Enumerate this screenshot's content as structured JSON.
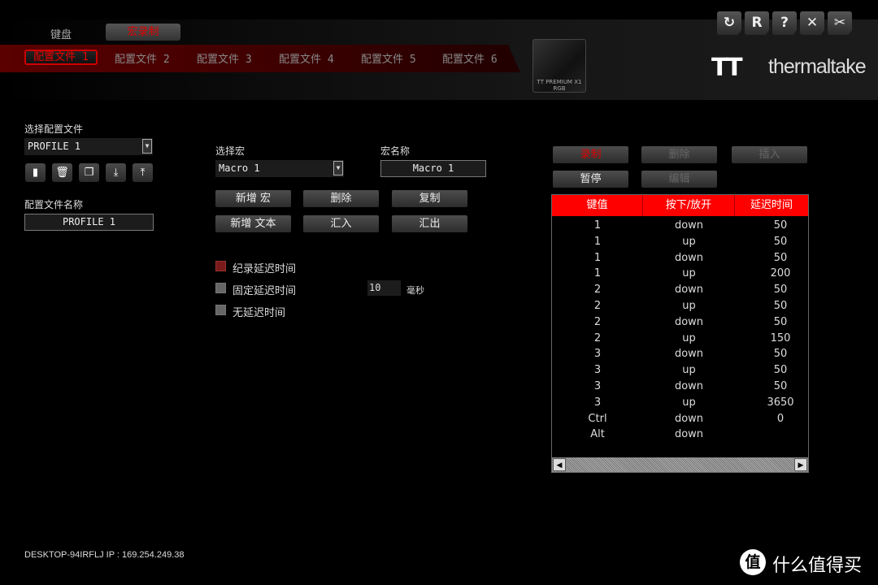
{
  "main_tabs": {
    "keyboard": "键盘",
    "macro": "宏录制"
  },
  "profile_tabs": [
    "配置文件 1",
    "配置文件 2",
    "配置文件 3",
    "配置文件 4",
    "配置文件 5",
    "配置文件 6"
  ],
  "device": {
    "name": "TT PREMIUM X1 RGB"
  },
  "window_buttons": [
    "refresh",
    "reset",
    "help",
    "close",
    "settings"
  ],
  "window_button_glyphs": {
    "refresh": "↻",
    "reset": "R",
    "help": "?",
    "close": "✕",
    "settings": "✂"
  },
  "brand": {
    "logo_mark": "TT",
    "name": "thermaltake"
  },
  "left": {
    "select_profile_label": "选择配置文件",
    "profile_value": "PROFILE 1",
    "profile_name_label": "配置文件名称",
    "profile_name_value": "PROFILE 1",
    "icons": {
      "new": "▮",
      "delete": "🗑",
      "copy": "❐",
      "import": "⤓",
      "export": "⤒"
    }
  },
  "middle": {
    "select_macro_label": "选择宏",
    "macro_value": "Macro 1",
    "macro_name_label": "宏名称",
    "macro_name_value": "Macro 1",
    "buttons": {
      "new_macro": "新增 宏",
      "delete": "删除",
      "copy": "复制",
      "new_text": "新增 文本",
      "import": "汇入",
      "export": "汇出"
    },
    "delay_options": {
      "record": "纪录延迟时间",
      "fixed": "固定延迟时间",
      "none": "无延迟时间"
    },
    "selected_delay_option": "record",
    "fixed_delay_value": "10",
    "fixed_delay_unit": "毫秒"
  },
  "right": {
    "buttons": {
      "record": "录制",
      "delete": "删除",
      "insert": "插入",
      "pause": "暂停",
      "edit": "编辑"
    },
    "table": {
      "headers": [
        "键值",
        "按下/放开",
        "延迟时间"
      ],
      "rows": [
        [
          "1",
          "down",
          "50"
        ],
        [
          "1",
          "up",
          "50"
        ],
        [
          "1",
          "down",
          "50"
        ],
        [
          "1",
          "up",
          "200"
        ],
        [
          "2",
          "down",
          "50"
        ],
        [
          "2",
          "up",
          "50"
        ],
        [
          "2",
          "down",
          "50"
        ],
        [
          "2",
          "up",
          "150"
        ],
        [
          "3",
          "down",
          "50"
        ],
        [
          "3",
          "up",
          "50"
        ],
        [
          "3",
          "down",
          "50"
        ],
        [
          "3",
          "up",
          "3650"
        ],
        [
          "Ctrl",
          "down",
          "0"
        ],
        [
          "Alt",
          "down",
          ""
        ]
      ]
    }
  },
  "footer": {
    "host_ip": "DESKTOP-94IRFLJ IP : 169.254.249.38",
    "watermark": "什么值得买",
    "watermark_icon": "值"
  },
  "colors": {
    "accent": "#ff0000",
    "header_red": "#ff0000"
  }
}
